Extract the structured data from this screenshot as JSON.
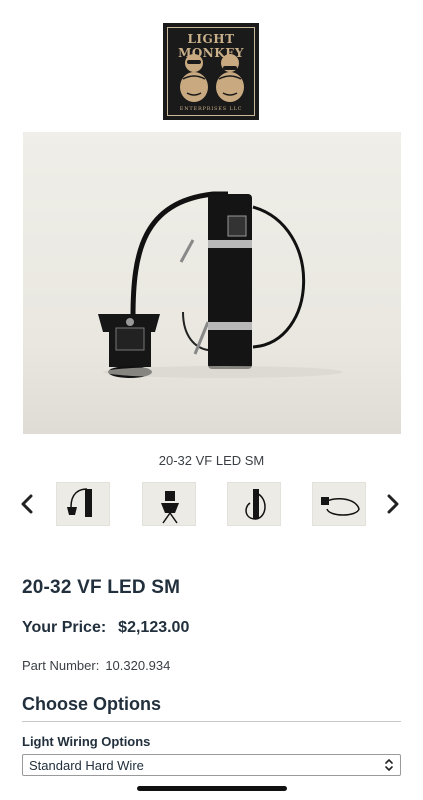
{
  "brand": {
    "name": "LIGHT MONKEY",
    "tagline": "ENTERPRISES LLC"
  },
  "gallery": {
    "caption": "20-32 VF LED SM",
    "prev_icon": "chevron-left-icon",
    "next_icon": "chevron-right-icon",
    "thumbnail_count": 4
  },
  "product": {
    "title": "20-32 VF LED SM",
    "price_label": "Your Price:",
    "price": "$2,123.00",
    "part_label": "Part Number:",
    "part_number": "10.320.934"
  },
  "options": {
    "heading": "Choose Options",
    "wiring_label": "Light Wiring Options",
    "wiring_selected": "Standard Hard Wire",
    "select_icon": "updown-chevron-icon"
  },
  "colors": {
    "text": "#22303d",
    "logo_bg": "#1a1a1a",
    "logo_gold": "#c9b08a"
  }
}
